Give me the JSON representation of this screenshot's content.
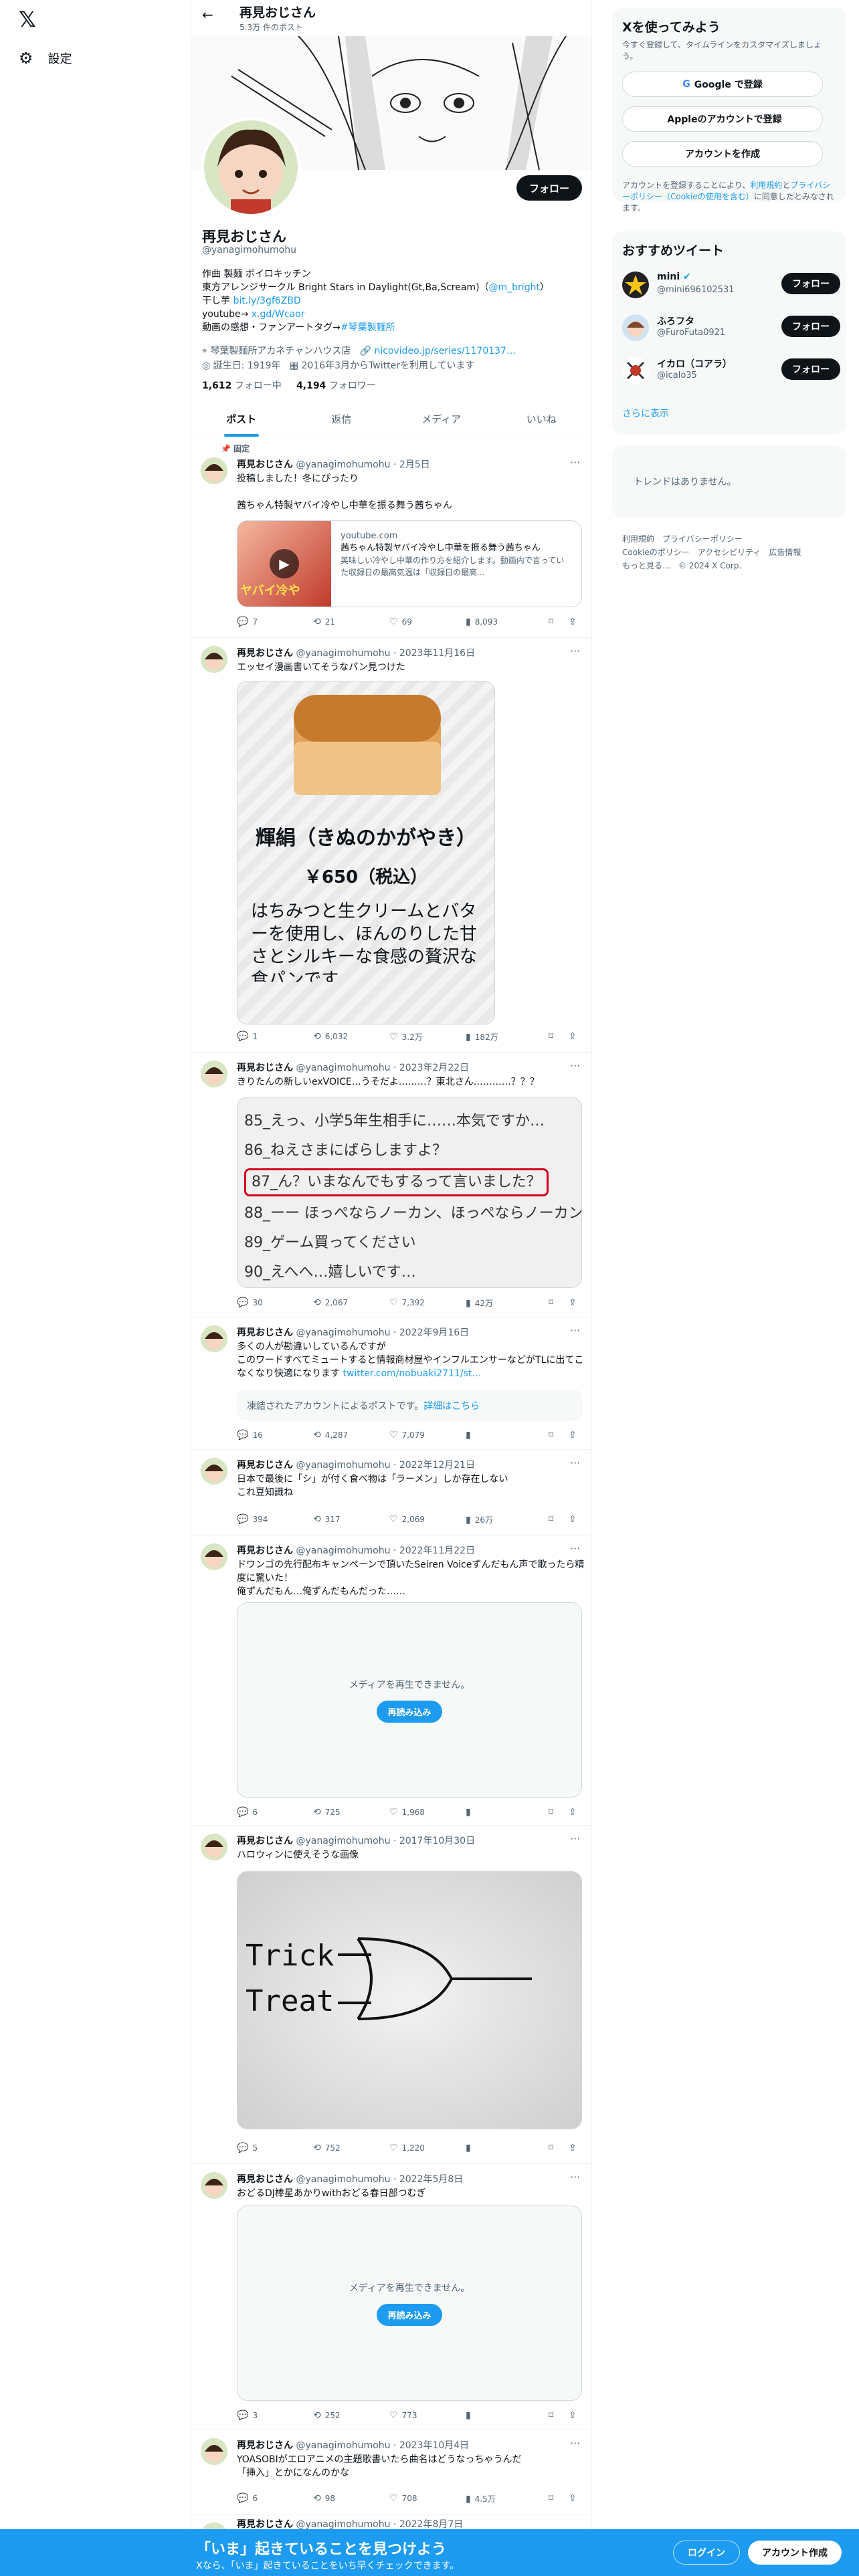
{
  "nav": {
    "logo": "𝕏",
    "settings_label": "設定",
    "settings_icon": "gear-icon"
  },
  "header": {
    "name": "再見おじさん",
    "post_count": "5.3万 件のポスト"
  },
  "profile": {
    "follow_label": "フォロー",
    "name": "再見おじさん",
    "handle": "@yanagimohumohu",
    "bio_line1": "作曲 製麺 ボイロキッチン",
    "bio_line2_pre": "東方アレンジサークル Bright Stars in Daylight(Gt,Ba,Scream)（",
    "bio_line2_link": "@m_bright",
    "bio_line2_post": "）",
    "bio_line3_pre": "干し芋 ",
    "bio_line3_link": "bit.ly/3gf6ZBD",
    "bio_line4_pre": "youtube→ ",
    "bio_line4_link": "x.gd/Wcaor",
    "bio_line5_pre": "動画の感想・ファンアートタグ→",
    "bio_line5_link": "#琴葉製麺所",
    "location": "琴葉製麺所アカネチャンハウス店",
    "website": "nicovideo.jp/series/1170137…",
    "birthday": "誕生日: 1919年",
    "joined": "2016年3月からTwitterを利用しています",
    "following_count": "1,612",
    "following_label": "フォロー中",
    "followers_count": "4,194",
    "followers_label": "フォロワー"
  },
  "tabs": [
    "ポスト",
    "返信",
    "メディア",
    "いいね"
  ],
  "tweets": [
    {
      "pinned": "固定",
      "name": "再見おじさん",
      "handle": "@yanagimohumohu",
      "date": "2月5日",
      "text": "投稿しました！冬にぴったり\n\n茜ちゃん特製ヤバイ冷やし中華を振る舞う茜ちゃん",
      "card_domain": "youtube.com",
      "card_title": "茜ちゃん特製ヤバイ冷やし中華を振る舞う茜ちゃん",
      "card_desc": "美味しい冷やし中華の作り方を紹介します。動画内で言っていた収録日の最高気温は「収録日の最高...",
      "card_thumb_text": "ヤバイ冷や",
      "replies": "7",
      "reposts": "21",
      "likes": "69",
      "views": "8,093"
    },
    {
      "name": "再見おじさん",
      "handle": "@yanagimohumohu",
      "date": "2023年11月16日",
      "text": "エッセイ漫画書いてそうなパン見つけた",
      "img_title": "輝絹（きぬのかがやき）",
      "img_price": "￥650（税込）",
      "img_desc": "はちみつと生クリームとバターを使用し、ほんのりした甘さとシルキーな食感の贅沢な食パンです",
      "replies": "1",
      "reposts": "6,032",
      "likes": "3.2万",
      "views": "182万"
    },
    {
      "name": "再見おじさん",
      "handle": "@yanagimohumohu",
      "date": "2023年2月22日",
      "text": "きりたんの新しいexVOICE…うそだよ………？東北さん…………？？？",
      "voice_lines": [
        "85_えっ、小学5年生相手に……本気ですか…",
        "86_ねえさまにばらしますよ？",
        "87_ん？いまなんでもするって言いました？",
        "88_ーー ほっぺならノーカン、ほっぺならノーカン",
        "89_ゲーム買ってください",
        "90_えへへ…嬉しいです…"
      ],
      "replies": "30",
      "reposts": "2,067",
      "likes": "7,392",
      "views": "42万"
    },
    {
      "name": "再見おじさん",
      "handle": "@yanagimohumohu",
      "date": "2022年9月16日",
      "text": "多くの人が勘違いしているんですが\nこのワードすべてミュートすると情報商材屋やインフルエンサーなどがTLに出てこなくなり快適になります ",
      "text_link": "twitter.com/nobuaki2711/st…",
      "frozen_text": "凍結されたアカウントによるポストです。",
      "frozen_link": "詳細はこちら",
      "replies": "16",
      "reposts": "4,287",
      "likes": "7,079",
      "views": ""
    },
    {
      "name": "再見おじさん",
      "handle": "@yanagimohumohu",
      "date": "2022年12月21日",
      "text": "日本で最後に「シ」が付く食べ物は「ラーメン」しか存在しない\nこれ豆知識ね",
      "replies": "394",
      "reposts": "317",
      "likes": "2,069",
      "views": "26万"
    },
    {
      "name": "再見おじさん",
      "handle": "@yanagimohumohu",
      "date": "2022年11月22日",
      "text": "ドワンゴの先行配布キャンペーンで頂いたSeiren Voiceずんだもん声で歌ったら精度に驚いた！\n俺ずんだもん…俺ずんだもんだった……",
      "media_error": "メディアを再生できません。",
      "reload_label": "再読み込み",
      "replies": "6",
      "reposts": "725",
      "likes": "1,968",
      "views": ""
    },
    {
      "name": "再見おじさん",
      "handle": "@yanagimohumohu",
      "date": "2017年10月30日",
      "text": "ハロウィンに使えそうな画像",
      "img_text1": "Trick",
      "img_text2": "Treat",
      "replies": "5",
      "reposts": "752",
      "likes": "1,220",
      "views": ""
    },
    {
      "name": "再見おじさん",
      "handle": "@yanagimohumohu",
      "date": "2022年5月8日",
      "text": "おどるDJ棒星あかりwithおどる春日部つむぎ",
      "media_error": "メディアを再生できません。",
      "reload_label": "再読み込み",
      "replies": "3",
      "reposts": "252",
      "likes": "773",
      "views": ""
    },
    {
      "name": "再見おじさん",
      "handle": "@yanagimohumohu",
      "date": "2023年10月4日",
      "text": "YOASOBIがエロアニメの主題歌書いたら曲名はどうなっちゃうんだ\n「挿入」とかになんのかな",
      "replies": "6",
      "reposts": "98",
      "likes": "708",
      "views": "4.5万"
    },
    {
      "name": "再見おじさん",
      "handle": "@yanagimohumohu",
      "date": "2022年8月7日"
    }
  ],
  "sidebar": {
    "signup_title": "Xを使ってみよう",
    "signup_desc": "今すぐ登録して、タイムラインをカスタマイズしましょう。",
    "google_label": "Google で登録",
    "apple_label": "Appleのアカウントで登録",
    "create_label": "アカウントを作成",
    "terms_pre": "アカウントを登録することにより、",
    "terms_link1": "利用規約",
    "terms_mid1": "と",
    "terms_link2": "プライバシーポリシー（Cookieの使用を含む）",
    "terms_post": "に同意したとみなされます。",
    "recommend_title": "おすすめツイート",
    "recommend": [
      {
        "name": "mini",
        "handle": "@mini696102531",
        "follow": "フォロー"
      },
      {
        "name": "ふろフタ",
        "handle": "@FuroFuta0921",
        "follow": "フォロー"
      },
      {
        "name": "イカロ（コアラ）",
        "handle": "@icalo35",
        "follow": "フォロー"
      }
    ],
    "show_more": "さらに表示",
    "trends_empty": "トレンドはありません。",
    "footer1": "利用規約　プライバシーポリシー",
    "footer2": "Cookieのポリシー　アクセシビリティ　広告情報",
    "footer3": "もっと見る…　© 2024 X Corp."
  },
  "bottombar": {
    "title": "「いま」起きていることを見つけよう",
    "subtitle": "Xなら、「いま」起きていることをいち早くチェックできます。",
    "login": "ログイン",
    "signup": "アカウント作成"
  },
  "colors": {
    "accent": "#1d9bf0",
    "text": "#0f1419",
    "muted": "#536471",
    "border": "#eff3f4"
  }
}
